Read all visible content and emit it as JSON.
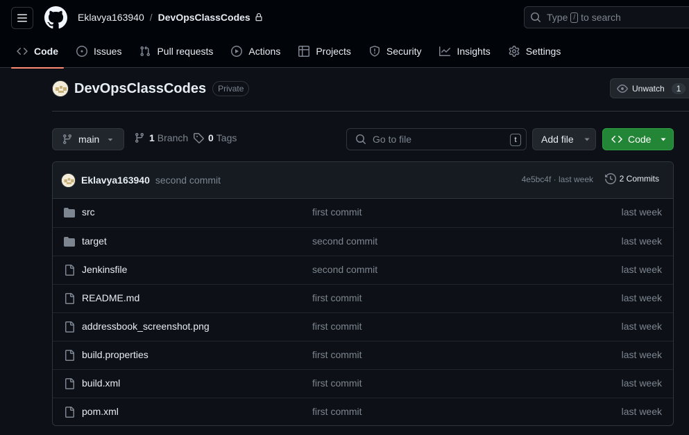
{
  "header": {
    "owner": "Eklavya163940",
    "separator": "/",
    "repo": "DevOpsClassCodes",
    "search_prefix": "Type",
    "search_key": "/",
    "search_suffix": "to search"
  },
  "tabs": [
    {
      "label": "Code",
      "icon": "code-icon",
      "active": true
    },
    {
      "label": "Issues",
      "icon": "issue-icon"
    },
    {
      "label": "Pull requests",
      "icon": "pull-request-icon"
    },
    {
      "label": "Actions",
      "icon": "play-icon"
    },
    {
      "label": "Projects",
      "icon": "table-icon"
    },
    {
      "label": "Security",
      "icon": "shield-icon"
    },
    {
      "label": "Insights",
      "icon": "graph-icon"
    },
    {
      "label": "Settings",
      "icon": "gear-icon"
    }
  ],
  "repo_head": {
    "name": "DevOpsClassCodes",
    "visibility": "Private",
    "watch_label": "Unwatch",
    "watch_count": "1"
  },
  "controls": {
    "branch": "main",
    "branch_count": "1",
    "branch_label": "Branch",
    "tag_count": "0",
    "tag_label": "Tags",
    "goto_placeholder": "Go to file",
    "goto_key": "t",
    "add_file": "Add file",
    "code": "Code"
  },
  "latest_commit": {
    "author": "Eklavya163940",
    "message": "second commit",
    "hash_time": "4e5bc4f · last week",
    "commits": "2 Commits"
  },
  "files": [
    {
      "type": "dir",
      "name": "src",
      "message": "first commit",
      "time": "last week"
    },
    {
      "type": "dir",
      "name": "target",
      "message": "second commit",
      "time": "last week"
    },
    {
      "type": "file",
      "name": "Jenkinsfile",
      "message": "second commit",
      "time": "last week"
    },
    {
      "type": "file",
      "name": "README.md",
      "message": "first commit",
      "time": "last week"
    },
    {
      "type": "file",
      "name": "addressbook_screenshot.png",
      "message": "first commit",
      "time": "last week"
    },
    {
      "type": "file",
      "name": "build.properties",
      "message": "first commit",
      "time": "last week"
    },
    {
      "type": "file",
      "name": "build.xml",
      "message": "first commit",
      "time": "last week"
    },
    {
      "type": "file",
      "name": "pom.xml",
      "message": "first commit",
      "time": "last week"
    }
  ],
  "colors": {
    "background": "#0d1117",
    "header_bg": "#010409",
    "border": "#30363d",
    "accent_underline": "#fd8c73",
    "primary_button": "#238636",
    "muted_text": "#7d8590",
    "folder_icon": "#7d8590"
  }
}
